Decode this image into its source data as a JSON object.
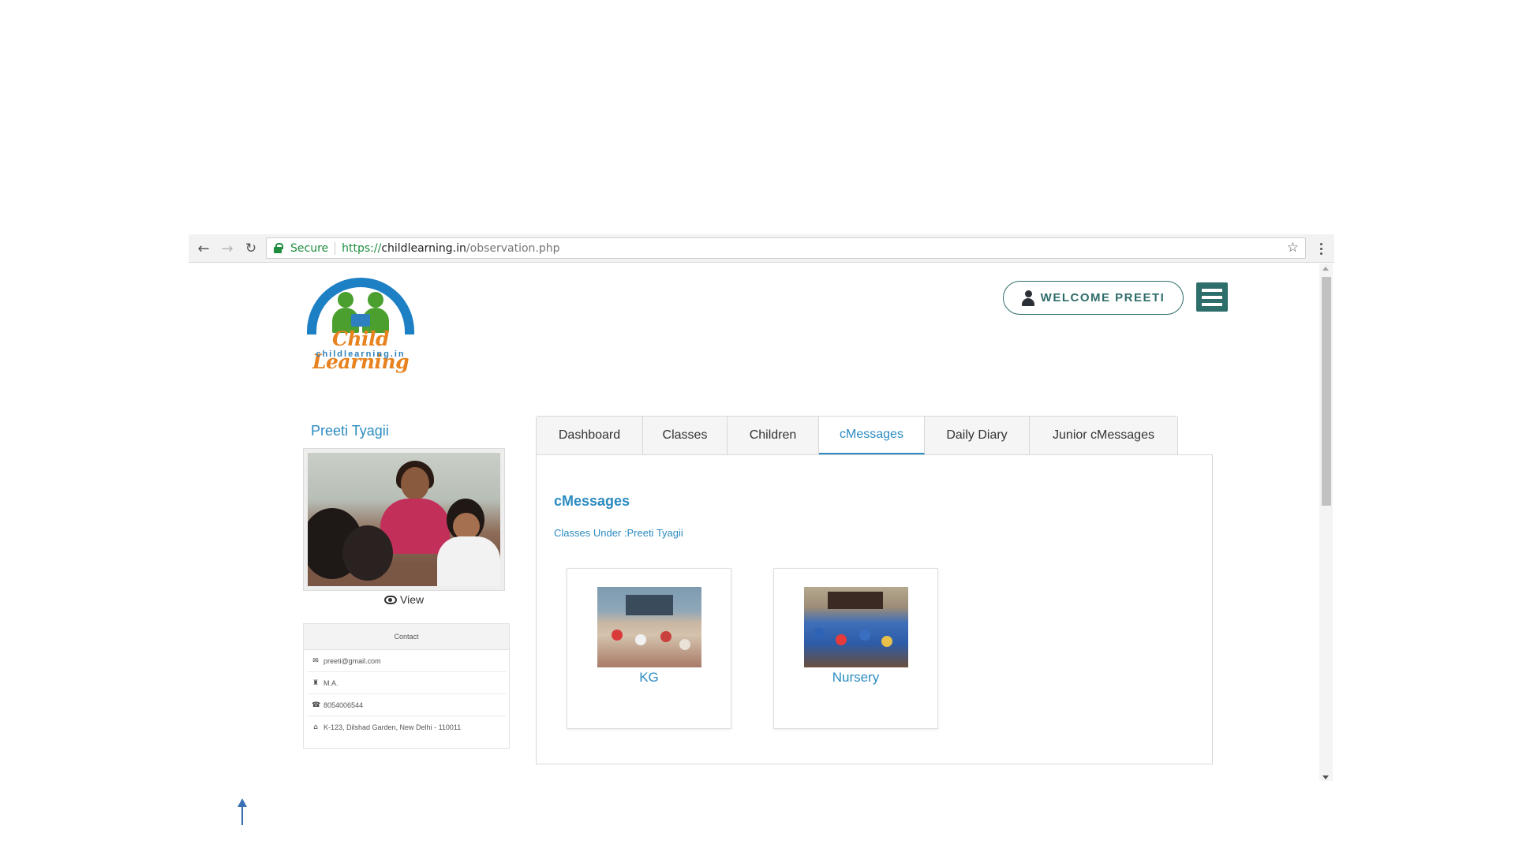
{
  "browser": {
    "secure_label": "Secure",
    "url_scheme": "https://",
    "url_host": "childlearning.in",
    "url_path": "/observation.php"
  },
  "logo": {
    "title": "Child Learning",
    "subtitle": "childlearning.in"
  },
  "header": {
    "welcome_label": "WELCOME PREETI"
  },
  "profile": {
    "name": "Preeti Tyagii",
    "view_label": "View",
    "contact": {
      "heading": "Contact",
      "email": "preeti@gmail.com",
      "qualification": "M.A.",
      "phone": "8054006544",
      "address": "K-123, Dilshad Garden, New Delhi - 110011"
    }
  },
  "tabs": [
    {
      "label": "Dashboard",
      "active": false
    },
    {
      "label": "Classes",
      "active": false
    },
    {
      "label": "Children",
      "active": false
    },
    {
      "label": "cMessages",
      "active": true
    },
    {
      "label": "Daily Diary",
      "active": false
    },
    {
      "label": "Junior cMessages",
      "active": false
    }
  ],
  "panel": {
    "title": "cMessages",
    "subtitle": "Classes Under :Preeti Tyagii",
    "classes": [
      {
        "name": "KG"
      },
      {
        "name": "Nursery"
      }
    ]
  },
  "colors": {
    "accent": "#2b8bc0",
    "brand_teal": "#2e6e6a",
    "logo_orange": "#e8821e",
    "logo_green": "#4a9f2f",
    "secure_green": "#1e8e3e"
  },
  "icons": {
    "back": "back-arrow-icon",
    "forward": "forward-arrow-icon",
    "reload": "reload-icon",
    "lock": "lock-icon",
    "star": "star-icon",
    "menu": "vertical-dots-icon",
    "user": "user-icon",
    "hamburger": "hamburger-menu-icon",
    "eye": "eye-icon",
    "email": "envelope-icon",
    "qualification": "graduation-cap-icon",
    "phone": "phone-icon",
    "address": "home-icon",
    "scroll_top": "up-arrow-icon"
  }
}
